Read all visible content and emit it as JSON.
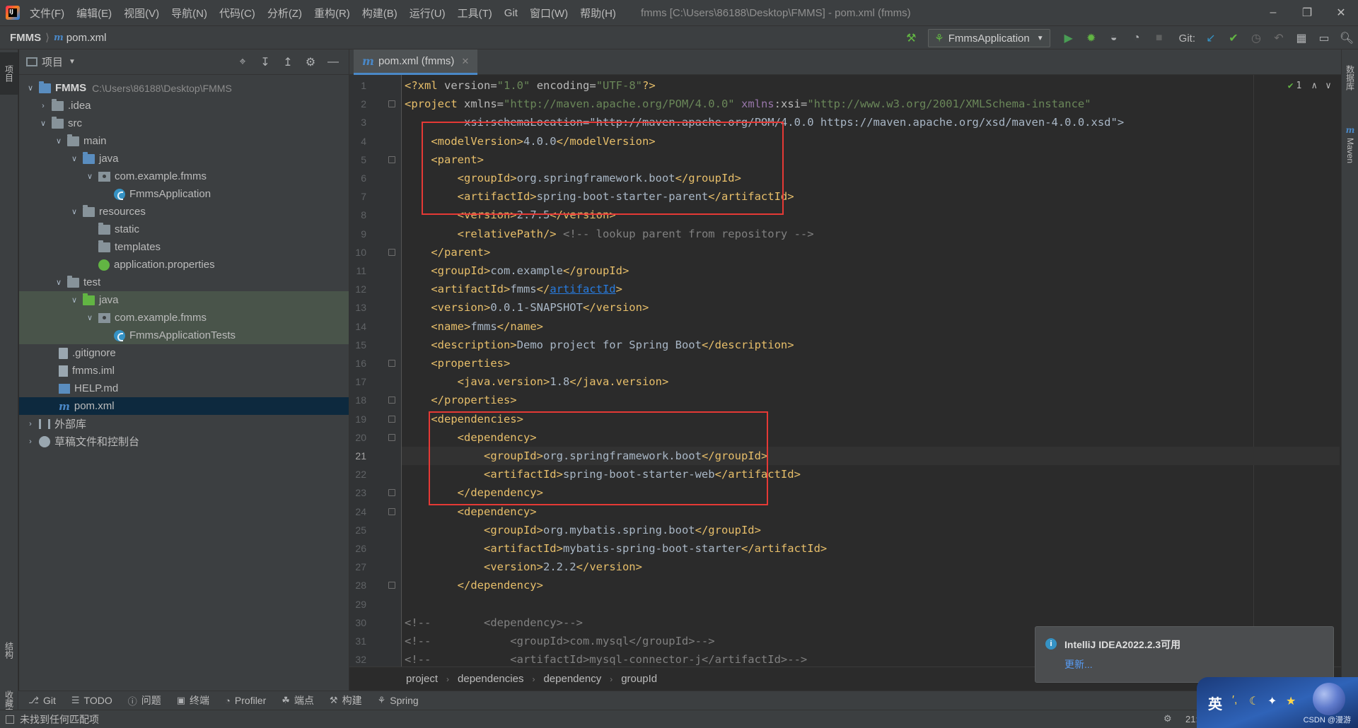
{
  "menubar": {
    "items": [
      "文件(F)",
      "编辑(E)",
      "视图(V)",
      "导航(N)",
      "代码(C)",
      "分析(Z)",
      "重构(R)",
      "构建(B)",
      "运行(U)",
      "工具(T)",
      "Git",
      "窗口(W)",
      "帮助(H)"
    ],
    "window_title": "fmms [C:\\Users\\86188\\Desktop\\FMMS] - pom.xml (fmms)"
  },
  "navbar": {
    "project": "FMMS",
    "file": "pom.xml",
    "run_config": "FmmsApplication",
    "git_label": "Git:"
  },
  "left_stripe": {
    "project_tab": "项目",
    "structure_tab": "结构",
    "favorites_tab": "收藏夹"
  },
  "project_panel": {
    "title": "项目",
    "tree": [
      {
        "label": "FMMS",
        "hint": "C:\\Users\\86188\\Desktop\\FMMS"
      },
      {
        "label": ".idea"
      },
      {
        "label": "src"
      },
      {
        "label": "main"
      },
      {
        "label": "java"
      },
      {
        "label": "com.example.fmms"
      },
      {
        "label": "FmmsApplication"
      },
      {
        "label": "resources"
      },
      {
        "label": "static"
      },
      {
        "label": "templates"
      },
      {
        "label": "application.properties"
      },
      {
        "label": "test"
      },
      {
        "label": "java"
      },
      {
        "label": "com.example.fmms"
      },
      {
        "label": "FmmsApplicationTests"
      },
      {
        "label": ".gitignore"
      },
      {
        "label": "fmms.iml"
      },
      {
        "label": "HELP.md"
      },
      {
        "label": "pom.xml"
      },
      {
        "label": "外部库"
      },
      {
        "label": "草稿文件和控制台"
      }
    ]
  },
  "editor": {
    "tab_label": "pom.xml (fmms)",
    "current_line": 21,
    "inspection_count": "1",
    "lines": [
      {
        "n": "1",
        "code": "<?xml version=\"1.0\" encoding=\"UTF-8\"?>"
      },
      {
        "n": "2",
        "code": "<project xmlns=\"http://maven.apache.org/POM/4.0.0\" xmlns:xsi=\"http://www.w3.org/2001/XMLSchema-instance\""
      },
      {
        "n": "3",
        "code": "         xsi:schemaLocation=\"http://maven.apache.org/POM/4.0.0 https://maven.apache.org/xsd/maven-4.0.0.xsd\">"
      },
      {
        "n": "4",
        "code": "    <modelVersion>4.0.0</modelVersion>"
      },
      {
        "n": "5",
        "code": "    <parent>"
      },
      {
        "n": "6",
        "code": "        <groupId>org.springframework.boot</groupId>"
      },
      {
        "n": "7",
        "code": "        <artifactId>spring-boot-starter-parent</artifactId>"
      },
      {
        "n": "8",
        "code": "        <version>2.7.5</version>"
      },
      {
        "n": "9",
        "code": "        <relativePath/> <!-- lookup parent from repository -->"
      },
      {
        "n": "10",
        "code": "    </parent>"
      },
      {
        "n": "11",
        "code": "    <groupId>com.example</groupId>"
      },
      {
        "n": "12",
        "code": "    <artifactId>fmms</artifactId>"
      },
      {
        "n": "13",
        "code": "    <version>0.0.1-SNAPSHOT</version>"
      },
      {
        "n": "14",
        "code": "    <name>fmms</name>"
      },
      {
        "n": "15",
        "code": "    <description>Demo project for Spring Boot</description>"
      },
      {
        "n": "16",
        "code": "    <properties>"
      },
      {
        "n": "17",
        "code": "        <java.version>1.8</java.version>"
      },
      {
        "n": "18",
        "code": "    </properties>"
      },
      {
        "n": "19",
        "code": "    <dependencies>"
      },
      {
        "n": "20",
        "code": "        <dependency>"
      },
      {
        "n": "21",
        "code": "            <groupId>org.springframework.boot</groupId>"
      },
      {
        "n": "22",
        "code": "            <artifactId>spring-boot-starter-web</artifactId>"
      },
      {
        "n": "23",
        "code": "        </dependency>"
      },
      {
        "n": "24",
        "code": "        <dependency>"
      },
      {
        "n": "25",
        "code": "            <groupId>org.mybatis.spring.boot</groupId>"
      },
      {
        "n": "26",
        "code": "            <artifactId>mybatis-spring-boot-starter</artifactId>"
      },
      {
        "n": "27",
        "code": "            <version>2.2.2</version>"
      },
      {
        "n": "28",
        "code": "        </dependency>"
      },
      {
        "n": "29",
        "code": ""
      },
      {
        "n": "30",
        "code": "<!--        <dependency>-->"
      },
      {
        "n": "31",
        "code": "<!--            <groupId>com.mysql</groupId>-->"
      },
      {
        "n": "32",
        "code": "<!--            <artifactId>mysql-connector-j</artifactId>-->"
      }
    ]
  },
  "breadcrumbs": [
    "project",
    "dependencies",
    "dependency",
    "groupId"
  ],
  "right_stripe": {
    "database_tab": "数据库",
    "maven_tab": "Maven"
  },
  "toolwindows": [
    {
      "icon": "git-icon",
      "label": "Git"
    },
    {
      "icon": "todo-icon",
      "label": "TODO"
    },
    {
      "icon": "problems-icon",
      "label": "问题"
    },
    {
      "icon": "terminal-icon",
      "label": "终端"
    },
    {
      "icon": "profiler-icon",
      "label": "Profiler"
    },
    {
      "icon": "endpoints-icon",
      "label": "端点"
    },
    {
      "icon": "build-icon",
      "label": "构建"
    },
    {
      "icon": "spring-icon",
      "label": "Spring"
    }
  ],
  "statusbar": {
    "text": "未找到任何匹配项",
    "time_partial": "21:"
  },
  "notification": {
    "title": "IntelliJ IDEA2022.2.3可用",
    "link": "更新..."
  },
  "ime": {
    "lang": "英",
    "watermark": "CSDN @漫游"
  },
  "colors": {
    "accent": "#4a88c7",
    "highlight_box": "#e53935",
    "xml_tag": "#e8bf6a",
    "xml_value": "#6a8759"
  }
}
